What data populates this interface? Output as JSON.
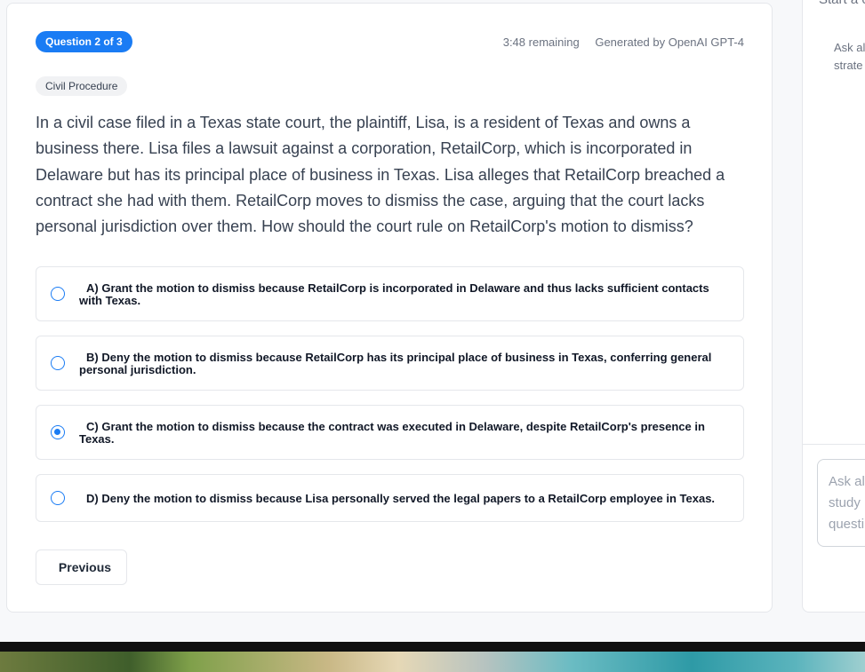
{
  "quiz": {
    "progress_label": "Question 2 of 3",
    "time_remaining": "3:48 remaining",
    "generated_by": "Generated by OpenAI GPT-4",
    "subject_tag": "Civil Procedure",
    "question": "In a civil case filed in a Texas state court, the plaintiff, Lisa, is a resident of Texas and owns a business there. Lisa files a lawsuit against a corporation, RetailCorp, which is incorporated in Delaware but has its principal place of business in Texas. Lisa alleges that RetailCorp breached a contract she had with them. RetailCorp moves to dismiss the case, arguing that the court lacks personal jurisdiction over them. How should the court rule on RetailCorp's motion to dismiss?",
    "options": [
      {
        "label": "A) Grant the motion to dismiss because RetailCorp is incorporated in Delaware and thus lacks sufficient contacts with Texas.",
        "selected": false
      },
      {
        "label": "B) Deny the motion to dismiss because RetailCorp has its principal place of business in Texas, conferring general personal jurisdiction.",
        "selected": false
      },
      {
        "label": "C) Grant the motion to dismiss because the contract was executed in Delaware, despite RetailCorp's presence in Texas.",
        "selected": true
      },
      {
        "label": "D) Deny the motion to dismiss because Lisa personally served the legal papers to a RetailCorp employee in Texas.",
        "selected": false
      }
    ],
    "previous_label": "Previous",
    "accent_color": "#1a7cf4"
  },
  "sidebar": {
    "top_text": "Start a c",
    "hint_text": "Ask al strate",
    "input_placeholder": "Ask al study questi"
  }
}
